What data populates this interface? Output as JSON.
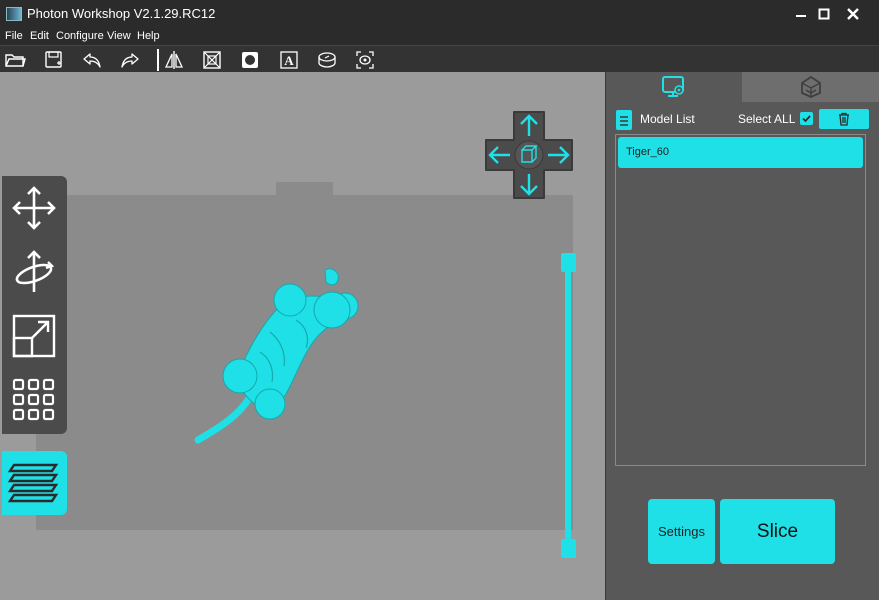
{
  "window": {
    "title": "Photon Workshop V2.1.29.RC12",
    "controls": [
      "minimize-icon",
      "maximize-icon",
      "close-icon"
    ]
  },
  "menu": {
    "items": [
      "File",
      "Edit",
      "Configure",
      "View",
      "Help"
    ]
  },
  "toolbar": {
    "tools": [
      "open-folder-icon",
      "save-icon",
      "undo-icon",
      "redo-icon",
      "mirror-icon",
      "hollow-icon",
      "punch-hole-icon",
      "text-icon",
      "cut-icon",
      "repair-icon"
    ]
  },
  "viewport": {
    "side_tools": [
      "move-icon",
      "rotate-icon",
      "scale-icon",
      "arrange-icon"
    ],
    "active_tool": "layers-icon",
    "nav": [
      "up-arrow-icon",
      "down-arrow-icon",
      "left-arrow-icon",
      "right-arrow-icon",
      "view-cube-icon"
    ]
  },
  "right_panel": {
    "tabs": [
      "model-settings-icon",
      "supports-icon"
    ],
    "model_list_title": "Model List",
    "select_all_label": "Select ALL",
    "select_all_checked": true,
    "models": [
      "Tiger_60"
    ],
    "settings_label": "Settings",
    "slice_label": "Slice"
  },
  "colors": {
    "accent": "#1fe0e6",
    "background": "#3a3a3a",
    "viewport": "#9b9b9b",
    "panel": "#585858"
  }
}
